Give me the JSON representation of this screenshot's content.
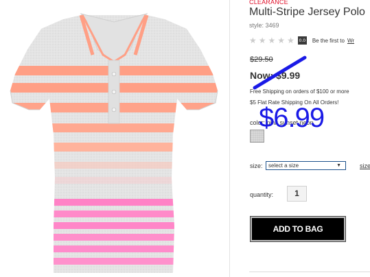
{
  "product": {
    "badge": "CLEARANCE",
    "title": "Multi-Stripe Jersey Polo",
    "style_label": "style:",
    "style_number": "3469",
    "rating_stars": 0,
    "rating_score": "0.0",
    "first_review_text": "Be the first to",
    "write_review_link": "Wr",
    "was_price": "$29.50",
    "now_price": "Now: $9.99",
    "shipping_line1": "Free Shipping on orders of $100 or more",
    "shipping_line2": "$5 Flat Rate Shipping On All Orders!",
    "color_label": "color: pink sunset neon",
    "size_label": "size:",
    "size_select_value": "select a size",
    "size_chart_link": "size",
    "quantity_label": "quantity:",
    "quantity_value": "1",
    "add_to_bag": "ADD TO BAG"
  },
  "annotation": {
    "new_price": "$6.99",
    "color": "#1a1ae6"
  },
  "colors": {
    "clearance": "#e0112b",
    "stripe_peach": "#ff9a80",
    "stripe_pink": "#ff7ac2",
    "shirt_base": "#e6e6e6"
  },
  "icons": {
    "stars": "star-icon",
    "dropdown": "chevron-down-icon"
  }
}
